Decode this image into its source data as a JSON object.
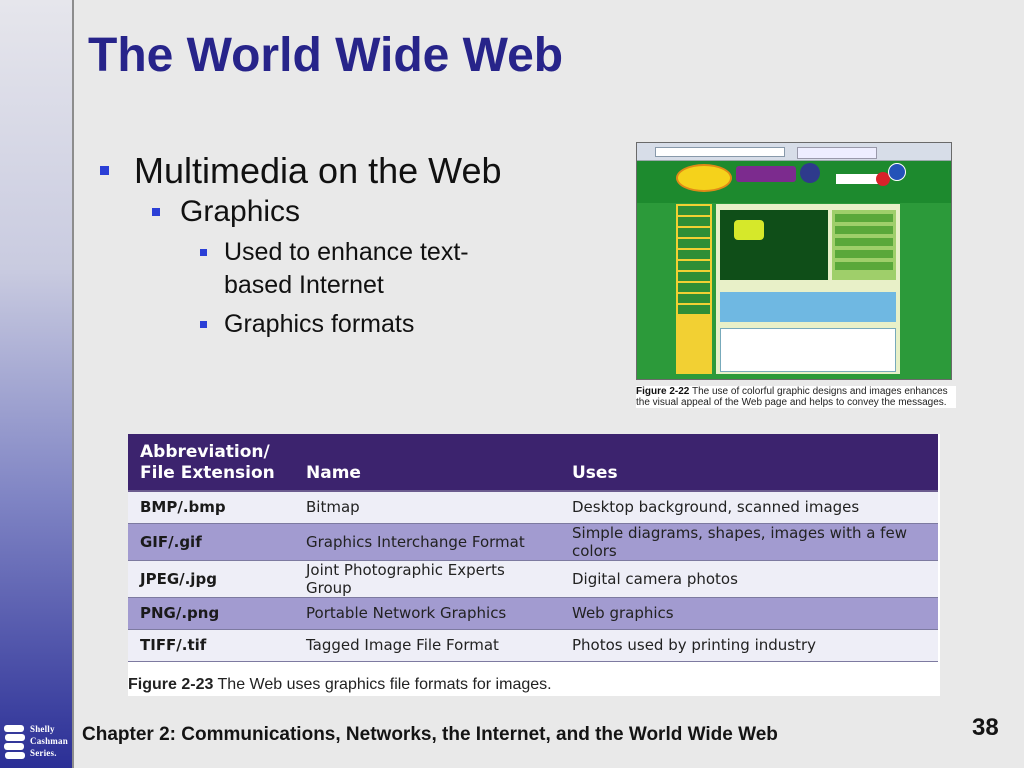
{
  "title": "The World Wide Web",
  "bullets": {
    "l1": "Multimedia on the Web",
    "l2": "Graphics",
    "l3a": "Used to enhance text-based Internet",
    "l3b": "Graphics formats"
  },
  "figure_22": {
    "label": "Figure 2-22",
    "caption": "The use of colorful graphic designs and images enhances the visual appeal of the Web page and helps to convey the messages."
  },
  "table": {
    "headers": [
      "Abbreviation/ File Extension",
      "Name",
      "Uses"
    ],
    "rows": [
      [
        "BMP/.bmp",
        "Bitmap",
        "Desktop background, scanned images"
      ],
      [
        "GIF/.gif",
        "Graphics Interchange Format",
        "Simple diagrams, shapes, images with a few colors"
      ],
      [
        "JPEG/.jpg",
        "Joint Photographic Experts Group",
        "Digital camera photos"
      ],
      [
        "PNG/.png",
        "Portable Network Graphics",
        "Web graphics"
      ],
      [
        "TIFF/.tif",
        "Tagged Image File Format",
        "Photos used by printing industry"
      ]
    ]
  },
  "figure_23": {
    "label": "Figure 2-23",
    "caption": "The Web uses graphics file formats for images."
  },
  "footer": "Chapter 2: Communications, Networks, the Internet, and the World Wide Web",
  "page_number": "38",
  "logo_text": [
    "Shelly",
    "Cashman",
    "Series."
  ],
  "colors": {
    "title": "#27248a",
    "table_header": "#3c236e",
    "row_light": "#eeeef7",
    "row_dark": "#a29bd0",
    "bullet": "#2b3fd6"
  }
}
